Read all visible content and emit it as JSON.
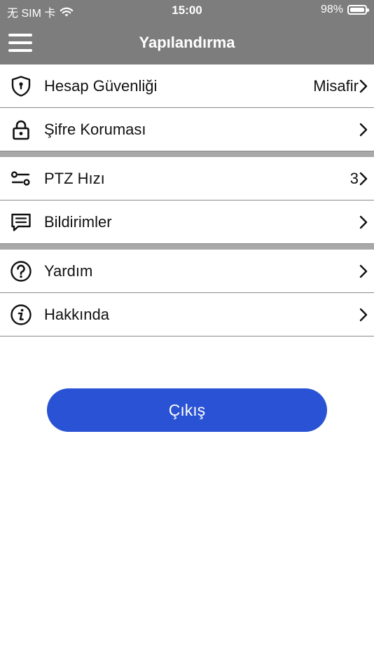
{
  "status_bar": {
    "carrier": "无 SIM 卡",
    "time": "15:00",
    "battery_percent": "98%",
    "battery_level": 0.98
  },
  "header": {
    "title": "Yapılandırma",
    "menu_icon": "hamburger-menu-icon"
  },
  "settings": {
    "groups": [
      {
        "items": [
          {
            "label": "Hesap Güvenliği",
            "value": "Misafir",
            "icon": "shield-keyhole-icon"
          },
          {
            "label": "Şifre Koruması",
            "value": "",
            "icon": "lock-icon"
          }
        ]
      },
      {
        "items": [
          {
            "label": "PTZ Hızı",
            "value": "3",
            "icon": "sliders-icon"
          },
          {
            "label": "Bildirimler",
            "value": "",
            "icon": "message-icon"
          }
        ]
      },
      {
        "items": [
          {
            "label": "Yardım",
            "value": "",
            "icon": "question-circle-icon"
          },
          {
            "label": "Hakkında",
            "value": "",
            "icon": "info-circle-icon"
          }
        ]
      }
    ]
  },
  "actions": {
    "logout_label": "Çıkış"
  },
  "colors": {
    "header_bg": "#7d7d7d",
    "divider": "#a8a8a8",
    "accent": "#2a52d4"
  }
}
